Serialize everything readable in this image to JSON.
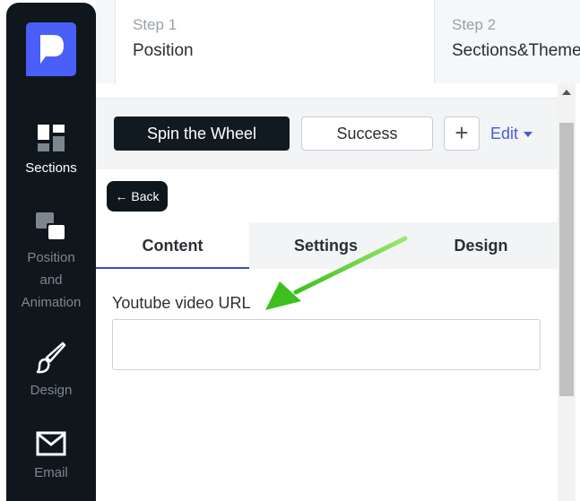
{
  "sidebar": {
    "items": [
      {
        "label": "Sections",
        "icon": "sections-icon",
        "active": true
      },
      {
        "label": "Position and Animation",
        "icon": "position-icon",
        "active": false
      },
      {
        "label": "Design",
        "icon": "brush-icon",
        "active": false
      },
      {
        "label": "Email",
        "icon": "envelope-icon",
        "active": false
      }
    ]
  },
  "steps": [
    {
      "number": "Step 1",
      "title": "Position"
    },
    {
      "number": "Step 2",
      "title": "Sections&Theme"
    }
  ],
  "toolbar": {
    "spin_label": "Spin the Wheel",
    "success_label": "Success",
    "add_label": "+",
    "edit_label": "Edit"
  },
  "back_label": "← Back",
  "tabs": [
    {
      "label": "Content",
      "active": true
    },
    {
      "label": "Settings",
      "active": false
    },
    {
      "label": "Design",
      "active": false
    }
  ],
  "field": {
    "label": "Youtube video URL",
    "value": "",
    "placeholder": ""
  },
  "colors": {
    "sidebar_bg": "#0f171d",
    "accent": "#3b4bd0",
    "logo": "#4a5ff7",
    "annotation_arrow": "#4fcf2f"
  }
}
